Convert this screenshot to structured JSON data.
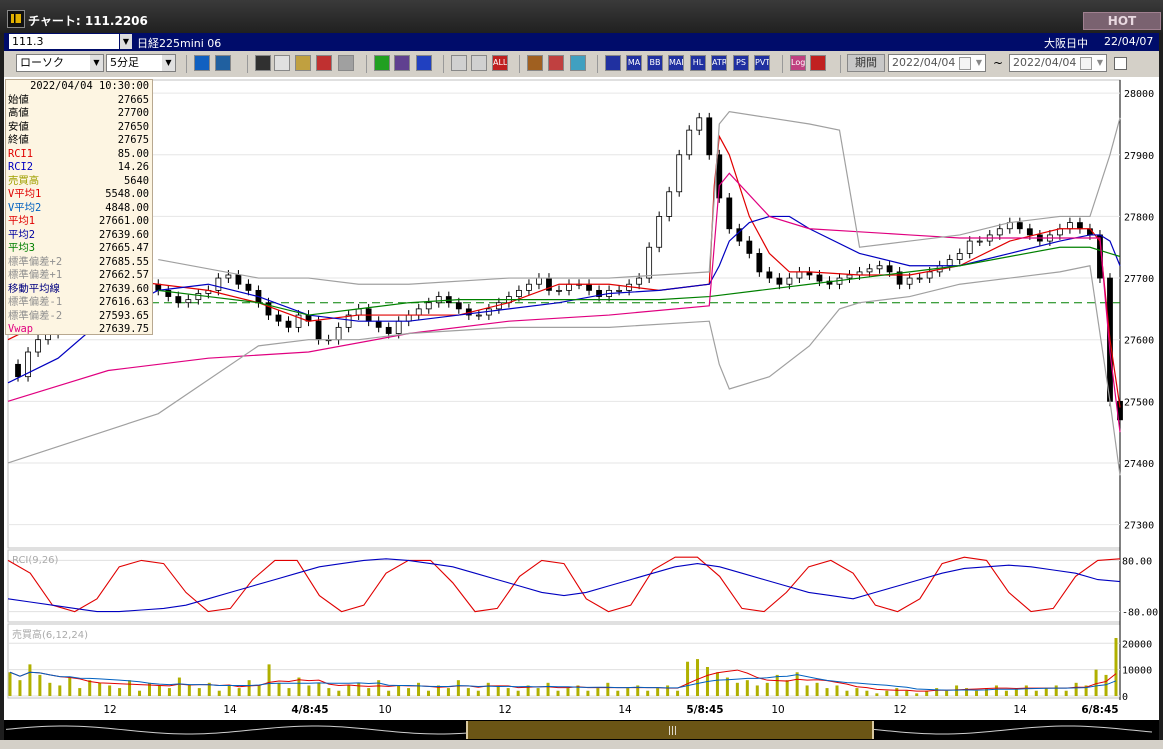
{
  "window": {
    "title": "チャート: 111.2206",
    "hot_label": "HOT"
  },
  "header": {
    "symbol": "111.3",
    "instrument": "日経225mini 06",
    "session": "大阪日中",
    "date": "22/04/07"
  },
  "toolbar": {
    "chart_type": "ローソク",
    "interval": "5分足",
    "period_label": "期間",
    "date_from": "2022/04/04",
    "date_to": "2022/04/04",
    "range_sep": "~",
    "buttons": [
      {
        "name": "zoom",
        "label": "",
        "color": "#1060c0"
      },
      {
        "name": "cursor",
        "label": "",
        "color": "#2060a0"
      },
      {
        "name": "drawline",
        "label": "",
        "color": "#303030"
      },
      {
        "name": "search",
        "label": "",
        "color": "#e0e0e0"
      },
      {
        "name": "magnify",
        "label": "",
        "color": "#c0a040"
      },
      {
        "name": "compare",
        "label": "",
        "color": "#c03030"
      },
      {
        "name": "disabled",
        "label": "",
        "color": "#a0a0a0"
      },
      {
        "name": "pen",
        "label": "",
        "color": "#20a020"
      },
      {
        "name": "arrow",
        "label": "",
        "color": "#604090"
      },
      {
        "name": "undo",
        "label": "",
        "color": "#2040c0"
      },
      {
        "name": "candle1",
        "label": "",
        "color": "#d0d0d0"
      },
      {
        "name": "candle2",
        "label": "",
        "color": "#d0d0d0"
      },
      {
        "name": "all",
        "label": "ALL",
        "color": "#c02020"
      },
      {
        "name": "grid",
        "label": "",
        "color": "#a06020"
      },
      {
        "name": "tools",
        "label": "",
        "color": "#c04040"
      },
      {
        "name": "palette",
        "label": "",
        "color": "#40a0c0"
      },
      {
        "name": "fib",
        "label": "",
        "color": "#2030a0"
      },
      {
        "name": "ma",
        "label": "MA",
        "color": "#2030a0"
      },
      {
        "name": "bb",
        "label": "BB",
        "color": "#2030a0"
      },
      {
        "name": "mae",
        "label": "MAE",
        "color": "#2030a0"
      },
      {
        "name": "hl",
        "label": "HL",
        "color": "#2030a0"
      },
      {
        "name": "atr",
        "label": "ATR",
        "color": "#2030a0"
      },
      {
        "name": "psar",
        "label": "PS",
        "color": "#2030a0"
      },
      {
        "name": "pvt",
        "label": "PVT",
        "color": "#2030a0"
      },
      {
        "name": "log",
        "label": "Log",
        "color": "#c04080"
      },
      {
        "name": "export",
        "label": "",
        "color": "#c02020"
      }
    ]
  },
  "info_panel": {
    "datetime": "2022/04/04  10:30:00",
    "rows": [
      {
        "label": "始値",
        "value": "27665",
        "color": "#000000"
      },
      {
        "label": "高値",
        "value": "27700",
        "color": "#000000"
      },
      {
        "label": "安値",
        "value": "27650",
        "color": "#000000"
      },
      {
        "label": "終値",
        "value": "27675",
        "color": "#000000"
      },
      {
        "label": "RCI1",
        "value": "85.00",
        "color": "#e00000"
      },
      {
        "label": "RCI2",
        "value": "14.26",
        "color": "#0000c0"
      },
      {
        "label": "売買高",
        "value": "5640",
        "color": "#a0a000"
      },
      {
        "label": "V平均1",
        "value": "5548.00",
        "color": "#e00000"
      },
      {
        "label": "V平均2",
        "value": "4848.00",
        "color": "#0060c0"
      },
      {
        "label": "平均1",
        "value": "27661.00",
        "color": "#e00000"
      },
      {
        "label": "平均2",
        "value": "27639.60",
        "color": "#0000a0"
      },
      {
        "label": "平均3",
        "value": "27665.47",
        "color": "#008000"
      },
      {
        "label": "標準偏差+2",
        "value": "27685.55",
        "color": "#909090"
      },
      {
        "label": "標準偏差+1",
        "value": "27662.57",
        "color": "#909090"
      },
      {
        "label": "移動平均線",
        "value": "27639.60",
        "color": "#000080"
      },
      {
        "label": "標準偏差-1",
        "value": "27616.63",
        "color": "#909090"
      },
      {
        "label": "標準偏差-2",
        "value": "27593.65",
        "color": "#909090"
      },
      {
        "label": "Vwap",
        "value": "27639.75",
        "color": "#e00080"
      }
    ]
  },
  "chart_data": {
    "type": "line",
    "price_axis": {
      "ticks": [
        "28000",
        "27900",
        "27800",
        "27700",
        "27600",
        "27500",
        "27400",
        "27300"
      ],
      "ylim": [
        27275,
        28010
      ]
    },
    "time_axis": {
      "ticks": [
        "12",
        "14",
        "4/8:45",
        "10",
        "12",
        "14",
        "5/8:45",
        "10",
        "12",
        "14",
        "6/8:45"
      ]
    },
    "reference_level": 27660,
    "series": [
      {
        "name": "price",
        "color": "#000000",
        "x": [
          0,
          10,
          20,
          30,
          40,
          50,
          60,
          70,
          80,
          90,
          100,
          110,
          120,
          130,
          140,
          150,
          160,
          170,
          180,
          190,
          200,
          210,
          220,
          230,
          240,
          250,
          260,
          270,
          280,
          290,
          300,
          310,
          320,
          330,
          340,
          350,
          360,
          370,
          380,
          390,
          400,
          410,
          420,
          430,
          440,
          450,
          460,
          470,
          480,
          490,
          500,
          510,
          520,
          530,
          540,
          550,
          560,
          570,
          580,
          590,
          600,
          610,
          620,
          630,
          640,
          650,
          660,
          670,
          680,
          690,
          700,
          710,
          720,
          730,
          740,
          750,
          760,
          770,
          780,
          790,
          800,
          810,
          820,
          830,
          840,
          850,
          860,
          870,
          880,
          890,
          900,
          910,
          920,
          930,
          940,
          950,
          960,
          970,
          980,
          990,
          1000,
          1010,
          1020,
          1030,
          1040,
          1050,
          1060,
          1070,
          1080,
          1090,
          1100,
          1110
        ],
        "y": [
          27560,
          27540,
          27580,
          27600,
          27610,
          27620,
          27640,
          27660,
          27680,
          27700,
          27705,
          27710,
          27705,
          27700,
          27690,
          27680,
          27670,
          27660,
          27665,
          27675,
          27680,
          27700,
          27705,
          27690,
          27680,
          27660,
          27640,
          27630,
          27620,
          27640,
          27630,
          27600,
          27600,
          27620,
          27640,
          27650,
          27630,
          27620,
          27610,
          27630,
          27640,
          27650,
          27660,
          27670,
          27660,
          27650,
          27640,
          27640,
          27650,
          27660,
          27670,
          27680,
          27690,
          27700,
          27680,
          27680,
          27690,
          27690,
          27680,
          27670,
          27680,
          27680,
          27690,
          27700,
          27750,
          27800,
          27840,
          27900,
          27940,
          27960,
          27900,
          27830,
          27780,
          27760,
          27740,
          27710,
          27700,
          27690,
          27700,
          27710,
          27705,
          27695,
          27690,
          27700,
          27705,
          27710,
          27715,
          27720,
          27710,
          27690,
          27700,
          27700,
          27710,
          27720,
          27730,
          27740,
          27760,
          27760,
          27770,
          27780,
          27790,
          27780,
          27770,
          27760,
          27770,
          27780,
          27790,
          27780,
          27770,
          27700,
          27500,
          27470
        ]
      },
      {
        "name": "平均1",
        "color": "#e00000",
        "x": [
          0,
          50,
          100,
          150,
          200,
          250,
          300,
          350,
          400,
          450,
          500,
          550,
          600,
          650,
          700,
          705,
          710,
          720,
          740,
          760,
          780,
          800,
          850,
          900,
          950,
          1000,
          1050,
          1080,
          1090,
          1100,
          1110
        ],
        "y": [
          27600,
          27640,
          27700,
          27690,
          27680,
          27660,
          27630,
          27640,
          27640,
          27640,
          27660,
          27690,
          27690,
          27680,
          27690,
          27850,
          27930,
          27900,
          27800,
          27740,
          27710,
          27710,
          27705,
          27705,
          27720,
          27760,
          27780,
          27780,
          27760,
          27600,
          27490
        ]
      },
      {
        "name": "平均2",
        "color": "#0000c0",
        "x": [
          0,
          50,
          100,
          150,
          200,
          250,
          300,
          350,
          400,
          450,
          500,
          550,
          600,
          650,
          700,
          710,
          720,
          740,
          760,
          780,
          800,
          850,
          900,
          950,
          1000,
          1050,
          1080,
          1090,
          1100,
          1110
        ],
        "y": [
          27530,
          27570,
          27640,
          27680,
          27690,
          27670,
          27640,
          27630,
          27630,
          27640,
          27650,
          27660,
          27675,
          27680,
          27690,
          27720,
          27760,
          27790,
          27800,
          27800,
          27780,
          27740,
          27720,
          27720,
          27740,
          27760,
          27770,
          27770,
          27760,
          27720
        ]
      },
      {
        "name": "平均3",
        "color": "#008000",
        "x": [
          150,
          200,
          250,
          300,
          350,
          400,
          450,
          500,
          550,
          600,
          650,
          700,
          750,
          800,
          850,
          900,
          950,
          1000,
          1050,
          1080,
          1100,
          1110
        ],
        "y": [
          27680,
          27670,
          27660,
          27640,
          27650,
          27660,
          27665,
          27665,
          27665,
          27665,
          27665,
          27670,
          27680,
          27690,
          27700,
          27710,
          27720,
          27735,
          27750,
          27750,
          27740,
          27735
        ]
      },
      {
        "name": "Vwap",
        "color": "#e00080",
        "x": [
          0,
          100,
          200,
          300,
          400,
          500,
          600,
          700,
          710,
          720,
          760,
          800,
          850,
          900,
          950,
          1000,
          1050,
          1090,
          1100,
          1110
        ],
        "y": [
          27500,
          27550,
          27570,
          27580,
          27610,
          27630,
          27640,
          27655,
          27850,
          27870,
          27800,
          27780,
          27775,
          27770,
          27765,
          27765,
          27765,
          27765,
          27580,
          27450
        ]
      },
      {
        "name": "標準偏差+2",
        "color": "#a0a0a0",
        "x": [
          150,
          250,
          300,
          350,
          400,
          500,
          600,
          700,
          710,
          720,
          760,
          800,
          830,
          850,
          900,
          950,
          1000,
          1050,
          1080,
          1100,
          1110
        ],
        "y": [
          27730,
          27700,
          27700,
          27690,
          27690,
          27700,
          27700,
          27710,
          27950,
          27970,
          27960,
          27950,
          27940,
          27750,
          27760,
          27770,
          27790,
          27800,
          27800,
          27900,
          27960
        ]
      },
      {
        "name": "標準偏差-2",
        "color": "#a0a0a0",
        "x": [
          0,
          150,
          250,
          300,
          350,
          400,
          500,
          600,
          700,
          710,
          720,
          760,
          800,
          830,
          850,
          900,
          950,
          1000,
          1050,
          1080,
          1100,
          1110
        ],
        "y": [
          27400,
          27480,
          27590,
          27600,
          27600,
          27610,
          27620,
          27620,
          27630,
          27560,
          27520,
          27540,
          27590,
          27650,
          27660,
          27670,
          27690,
          27700,
          27710,
          27720,
          27500,
          27380
        ]
      }
    ],
    "rci": {
      "label": "RCI(9,26)",
      "ticks": [
        "80.00",
        "-80.00"
      ],
      "ylim": [
        -100,
        100
      ],
      "series": [
        {
          "name": "RCI1",
          "color": "#e00000",
          "values": [
            80,
            40,
            -60,
            -80,
            -40,
            60,
            80,
            70,
            -20,
            -80,
            -70,
            20,
            80,
            80,
            -30,
            -80,
            -60,
            40,
            80,
            80,
            10,
            -80,
            -70,
            30,
            80,
            70,
            -40,
            -80,
            -60,
            50,
            90,
            90,
            30,
            -70,
            -80,
            -20,
            60,
            80,
            40,
            -60,
            -80,
            -40,
            70,
            90,
            80,
            -20,
            -80,
            -70,
            30,
            80,
            85
          ]
        },
        {
          "name": "RCI2",
          "color": "#0000c0",
          "values": [
            -40,
            -50,
            -60,
            -70,
            -80,
            -80,
            -75,
            -70,
            -60,
            -40,
            -20,
            0,
            20,
            40,
            60,
            70,
            80,
            85,
            80,
            70,
            60,
            40,
            20,
            0,
            -20,
            -30,
            -20,
            0,
            20,
            40,
            60,
            70,
            60,
            40,
            20,
            0,
            -20,
            -30,
            -40,
            -20,
            0,
            20,
            40,
            55,
            60,
            65,
            60,
            50,
            40,
            20,
            14
          ]
        }
      ]
    },
    "volume": {
      "label": "売買高(6,12,24)",
      "ticks": [
        "20000",
        "10000",
        "0"
      ],
      "ylim": [
        0,
        22000
      ],
      "bars": [
        9000,
        6000,
        12000,
        8000,
        5000,
        4000,
        7000,
        3000,
        6000,
        5000,
        4000,
        3000,
        6000,
        2000,
        5000,
        4000,
        3000,
        7000,
        4000,
        3000,
        5000,
        2000,
        4000,
        3000,
        6000,
        4000,
        12000,
        5000,
        3000,
        7000,
        4000,
        5000,
        3000,
        2000,
        4000,
        5000,
        3000,
        6000,
        2000,
        4000,
        3000,
        5000,
        2000,
        4000,
        3000,
        6000,
        3000,
        2000,
        5000,
        4000,
        3000,
        2000,
        4000,
        3000,
        5000,
        2000,
        3000,
        4000,
        2000,
        3000,
        5000,
        2000,
        3000,
        4000,
        2000,
        3000,
        4000,
        2000,
        13000,
        14000,
        11000,
        9000,
        7000,
        5000,
        6000,
        4000,
        5000,
        8000,
        6000,
        9000,
        4000,
        5000,
        3000,
        4000,
        2000,
        3000,
        2000,
        1000,
        2000,
        3000,
        2000,
        1000,
        2000,
        3000,
        2000,
        4000,
        3000,
        2000,
        3000,
        4000,
        2000,
        3000,
        4000,
        2000,
        3000,
        4000,
        2000,
        5000,
        4000,
        10000,
        8000,
        22000
      ],
      "lines": [
        {
          "name": "V平均1",
          "color": "#e00000"
        },
        {
          "name": "V平均2",
          "color": "#0060c0"
        }
      ]
    }
  }
}
